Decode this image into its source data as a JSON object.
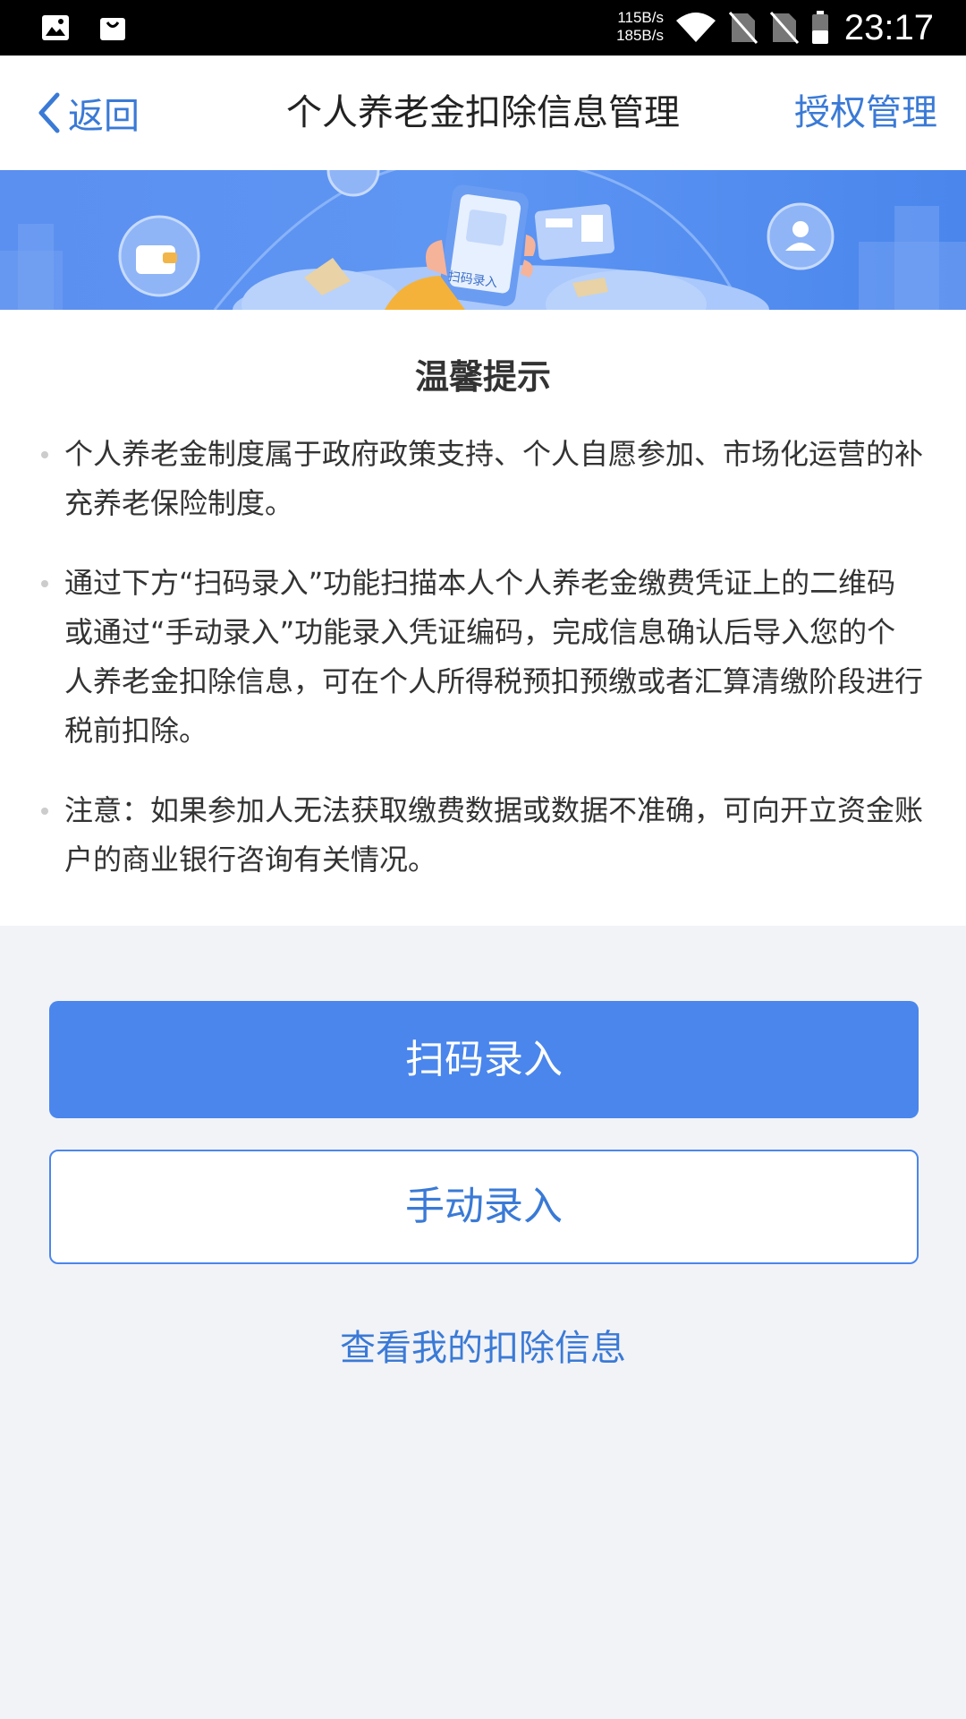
{
  "status_bar": {
    "speed_up": "115B/s",
    "speed_down": "185B/s",
    "time": "23:17",
    "icons": [
      "image-icon",
      "shopping-bag-icon",
      "wifi-icon",
      "no-sim-icon",
      "no-sim-icon",
      "battery-icon"
    ]
  },
  "nav": {
    "back_label": "返回",
    "title": "个人养老金扣除信息管理",
    "auth_label": "授权管理"
  },
  "banner": {
    "phone_label": "扫码录入"
  },
  "tips": {
    "title": "温馨提示",
    "items": [
      "个人养老金制度属于政府政策支持、个人自愿参加、市场化运营的补充养老保险制度。",
      "通过下方“扫码录入”功能扫描本人个人养老金缴费凭证上的二维码或通过“手动录入”功能录入凭证编码，完成信息确认后导入您的个人养老金扣除信息，可在个人所得税预扣预缴或者汇算清缴阶段进行税前扣除。",
      "注意：如果参加人无法获取缴费数据或数据不准确，可向开立资金账户的商业银行咨询有关情况。"
    ]
  },
  "actions": {
    "scan_label": "扫码录入",
    "manual_label": "手动录入",
    "view_label": "查看我的扣除信息"
  },
  "colors": {
    "accent": "#4a86ec",
    "link": "#3a7ad6",
    "page_bg": "#f2f3f7"
  }
}
